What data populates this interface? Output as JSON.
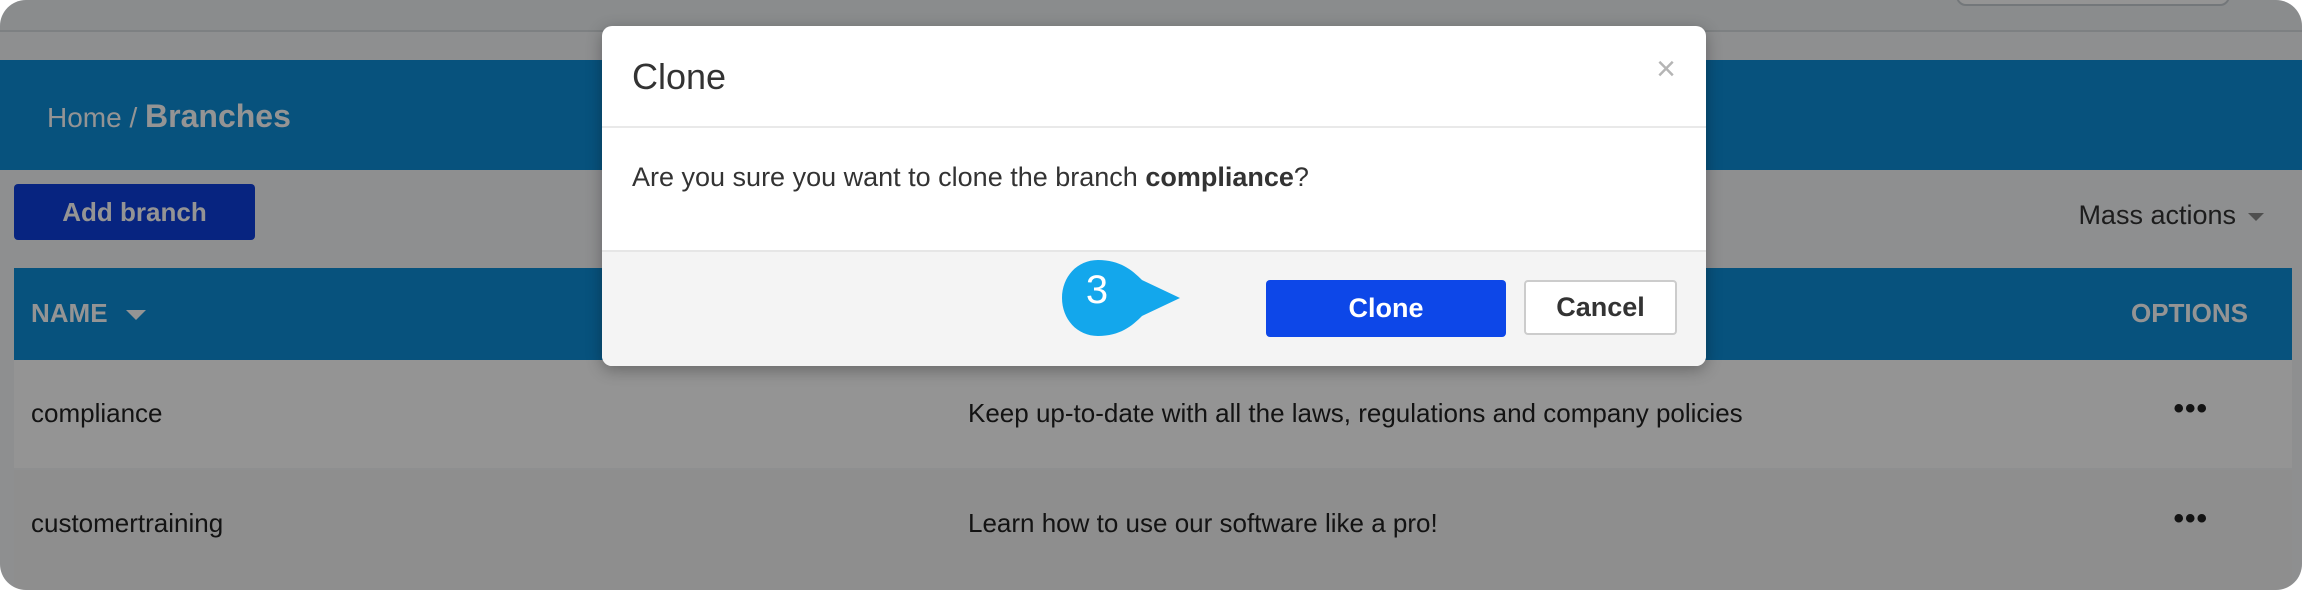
{
  "breadcrumb": {
    "home": "Home /",
    "current": "Branches"
  },
  "actions": {
    "add_branch": "Add branch",
    "mass_actions": "Mass actions"
  },
  "table": {
    "columns": {
      "name": "NAME",
      "options": "OPTIONS"
    },
    "rows": [
      {
        "name": "compliance",
        "description": "Keep up-to-date with all the laws, regulations and company policies",
        "options": "•••"
      },
      {
        "name": "customertraining",
        "description": "Learn how to use our software like a pro!",
        "options": "•••"
      }
    ]
  },
  "dialog": {
    "title": "Clone",
    "close": "×",
    "message_prefix": "Are you sure you want to clone the branch ",
    "branch": "compliance",
    "message_suffix": "?",
    "confirm": "Clone",
    "cancel": "Cancel"
  },
  "step_marker": {
    "number": "3",
    "color": "#13a7ec"
  },
  "icons": {
    "close": "close-icon",
    "sort": "sort-caret-icon",
    "dropdown": "chevron-down-icon",
    "options": "more-options-icon"
  },
  "colors": {
    "header": "#0d8ed8",
    "primary_button": "#0d47e8",
    "add_button": "#0d3edc"
  }
}
